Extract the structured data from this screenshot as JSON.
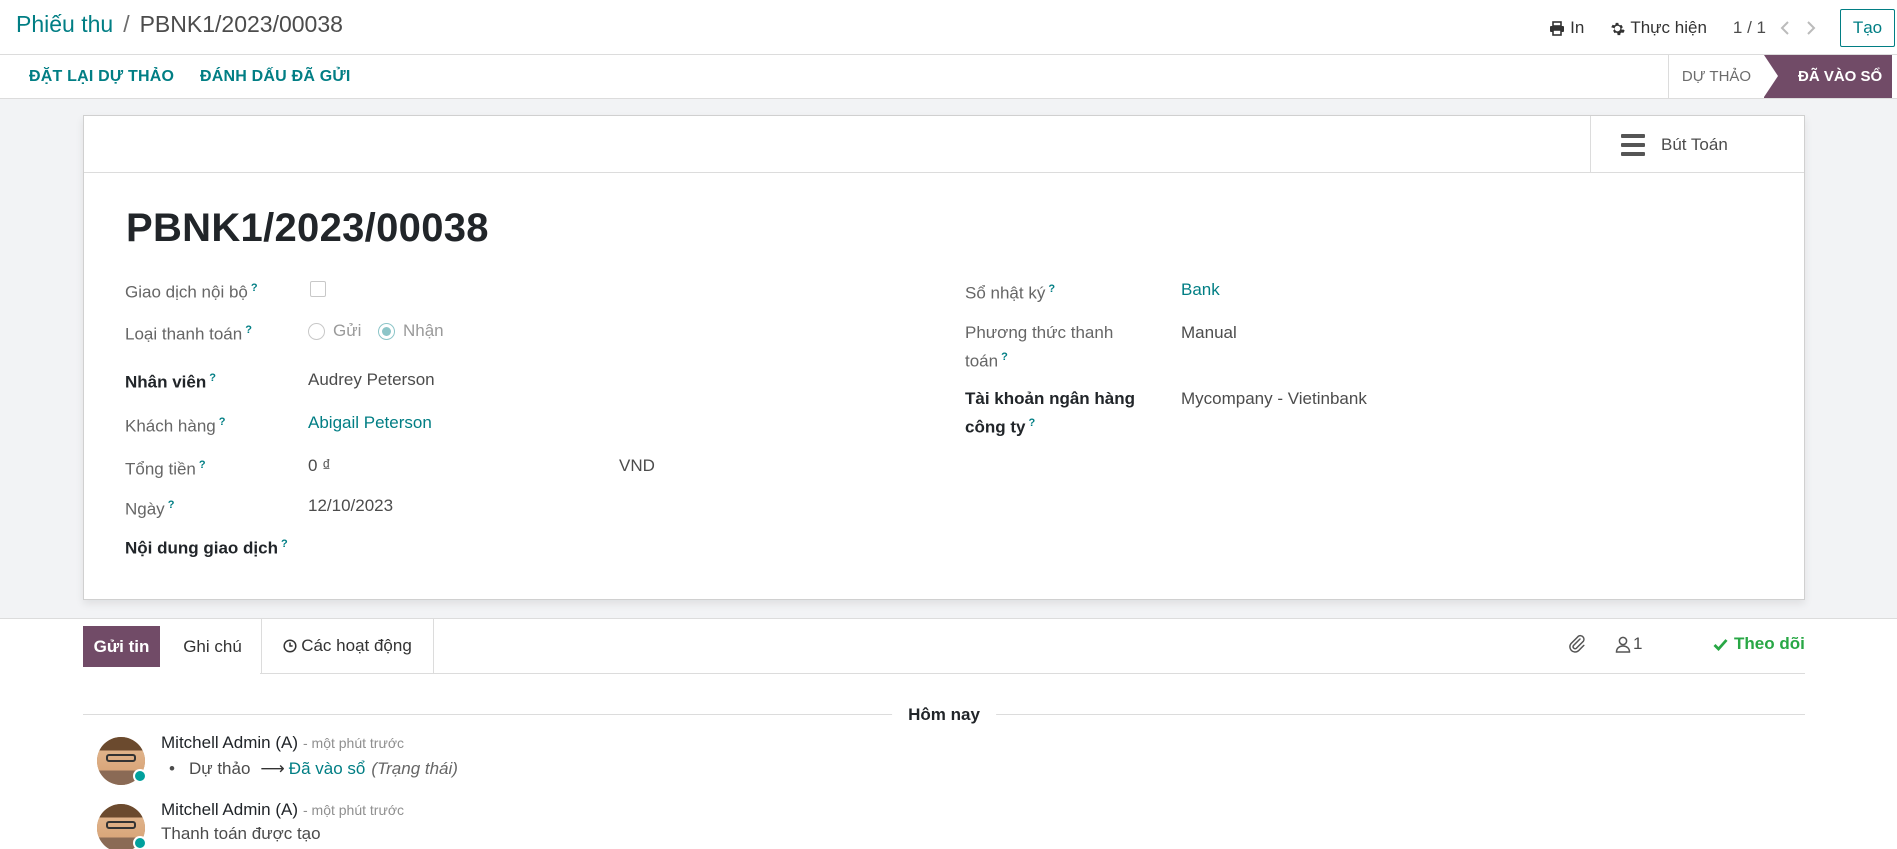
{
  "breadcrumb": {
    "parent": "Phiếu thu",
    "separator": "/",
    "current": "PBNK1/2023/00038"
  },
  "toolbar": {
    "print_label": "In",
    "action_label": "Thực hiện",
    "pager": "1 / 1",
    "create_label": "Tạo"
  },
  "actions": {
    "reset_draft": "ĐẶT LẠI DỰ THẢO",
    "mark_sent": "ĐÁNH DẤU ĐÃ GỬI"
  },
  "status": {
    "draft": "DỰ THẢO",
    "posted": "ĐÃ VÀO SỔ",
    "active": "posted"
  },
  "smart_button": {
    "label": "Bút Toán",
    "icon": "bars-icon"
  },
  "record": {
    "title": "PBNK1/2023/00038",
    "left": {
      "internal_transfer": {
        "label": "Giao dịch nội bộ",
        "help": "?",
        "checked": false
      },
      "payment_type": {
        "label": "Loại thanh toán",
        "help": "?",
        "options": [
          "Gửi",
          "Nhận"
        ],
        "selected": "Nhận"
      },
      "employee": {
        "label": "Nhân viên",
        "help": "?",
        "value": "Audrey Peterson"
      },
      "customer": {
        "label": "Khách hàng",
        "help": "?",
        "value": "Abigail Peterson"
      },
      "amount": {
        "label": "Tổng tiền",
        "help": "?",
        "value": "0 ₫",
        "currency": "VND"
      },
      "date": {
        "label": "Ngày",
        "help": "?",
        "value": "12/10/2023"
      },
      "memo": {
        "label": "Nội dung giao dịch",
        "help": "?",
        "value": ""
      }
    },
    "right": {
      "journal": {
        "label": "Sổ nhật ký",
        "help": "?",
        "value": "Bank"
      },
      "method": {
        "label_line1": "Phương thức thanh",
        "label_line2": "toán",
        "help": "?",
        "value": "Manual"
      },
      "bank": {
        "label_line1": "Tài khoản ngân hàng",
        "label_line2": "công ty",
        "help": "?",
        "value": "Mycompany - Vietinbank"
      }
    }
  },
  "chatter": {
    "send_label": "Gửi tin",
    "note_label": "Ghi chú",
    "activities_label": "Các hoạt động",
    "followers_count": "1",
    "follow_label": "Theo dõi",
    "day_separator": "Hôm nay",
    "messages": [
      {
        "author": "Mitchell Admin (A)",
        "time": "- một phút trước",
        "old_value": "Dự thảo",
        "new_value": "Đã vào sổ",
        "field": "(Trạng thái)"
      },
      {
        "author": "Mitchell Admin (A)",
        "time": "- một phút trước",
        "body": "Thanh toán được tạo"
      }
    ]
  },
  "colors": {
    "primary": "#017e84",
    "brand": "#714b67",
    "success": "#28a745"
  }
}
